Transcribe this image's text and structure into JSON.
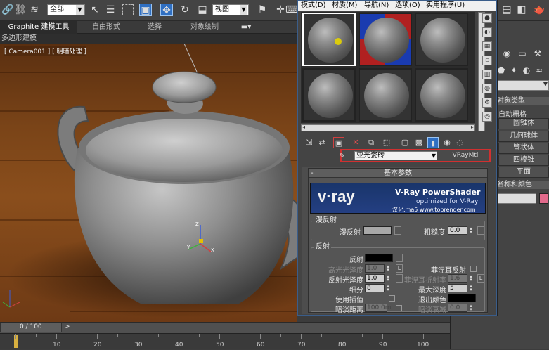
{
  "toolbar": {
    "selection_filter": "全部",
    "ref_coord": "视图"
  },
  "ribbon": {
    "tabs": [
      "Graphite 建模工具",
      "自由形式",
      "选择",
      "对象绘制"
    ],
    "subtab": "多边形建模"
  },
  "viewport": {
    "label": "[ Camera001 ] [ 明暗处理 ]",
    "axis_labels": [
      "Z",
      "Y",
      "X"
    ]
  },
  "timeline": {
    "frame": "0 / 100",
    "ticks": [
      "10",
      "20",
      "30",
      "40",
      "50",
      "60",
      "70",
      "80",
      "90",
      "100"
    ]
  },
  "command_panel": {
    "header": "对象类型",
    "subheader": "自动栅格",
    "buttons": [
      "圆锥体",
      "几何球体",
      "管状体",
      "四棱锥",
      "平面"
    ],
    "name_color": "名称和颜色",
    "swatch_color": "#e26a8c"
  },
  "material_editor": {
    "menu": [
      "模式(D)",
      "材质(M)",
      "导航(N)",
      "选项(O)",
      "实用程序(U)"
    ],
    "material_name": "亚光瓷砖",
    "material_type": "VRayMtl",
    "rollout_title": "基本参数",
    "banner": {
      "logo": "v·ray",
      "title": "V-Ray PowerShader",
      "subtitle": "optimized for V-Ray",
      "credit": "汉化.ma5 www.toprender.com"
    },
    "diffuse": {
      "group": "漫反射",
      "diffuse_label": "漫反射",
      "diffuse_color": "#a8a8a8",
      "roughness_label": "粗糙度",
      "roughness_value": "0.0"
    },
    "reflection": {
      "group": "反射",
      "reflect_label": "反射",
      "reflect_color": "#000000",
      "hilight_gloss_label": "高光光泽度",
      "hilight_gloss_value": "1.0",
      "lock_label": "L",
      "fresnel_label": "菲涅耳反射",
      "refl_gloss_label": "反射光泽度",
      "refl_gloss_value": "1.0",
      "fresnel_ior_label": "菲涅耳折射率",
      "fresnel_ior_lock": "L",
      "fresnel_ior_value": "1.6",
      "subdivs_label": "细分",
      "subdivs_value": "8",
      "max_depth_label": "最大深度",
      "max_depth_value": "5",
      "use_interp_label": "使用插值",
      "exit_color_label": "退出颜色",
      "exit_color": "#000000",
      "dim_dist_label": "暗淡距离",
      "dim_dist_value": "100.0m",
      "dim_falloff_label": "暗淡衰减",
      "dim_falloff_value": "0.0"
    }
  }
}
